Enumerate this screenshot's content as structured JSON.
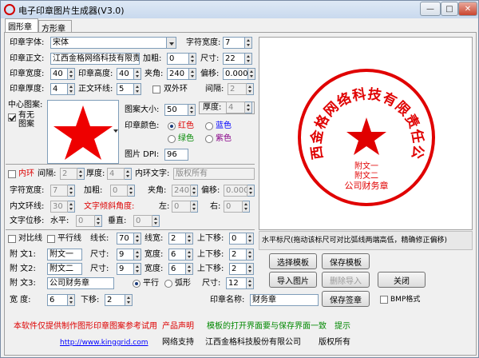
{
  "window": {
    "title": "电子印章图片生成器(V3.0)",
    "min": "—",
    "max": "□",
    "close": "✕"
  },
  "tabs": [
    {
      "label": "圆形章"
    },
    {
      "label": "方形章"
    }
  ],
  "form": {
    "font_label": "印章字体:",
    "font_value": "宋体",
    "char_width_label": "字符宽度:",
    "char_width": "7",
    "text_label": "印章正文:",
    "text_value": "江西金格网络科技有限责",
    "bold_label": "加粗:",
    "bold": "0",
    "size_label": "尺寸:",
    "size": "22",
    "seal_width_label": "印章宽度:",
    "seal_width": "40",
    "seal_height_label": "印章高度:",
    "seal_height": "40",
    "angle_label": "夹角:",
    "angle": "240",
    "offset_label": "偏移:",
    "offset": "0.000",
    "thickness_label": "印章厚度:",
    "thickness": "4",
    "text_ring_label": "正文环线:",
    "text_ring": "5",
    "double_ring_label": "双外环",
    "gap_label": "间隔:",
    "gap": "2",
    "center_label": "中心图案:",
    "has_pattern_label": "有无图案",
    "ring_thickness_label": "厚度:",
    "ring_thickness": "4",
    "pattern_size_label": "图案大小:",
    "pattern_size": "50",
    "color_label": "印章颜色:",
    "colors": {
      "red": "红色",
      "blue": "蓝色",
      "green": "绿色",
      "purple": "紫色"
    },
    "dpi_label": "图片 DPI:",
    "dpi": "96"
  },
  "inner": {
    "inner_ring_label": "内环",
    "gap_label": "间隔:",
    "gap": "2",
    "thickness_label": "厚度:",
    "thickness": "4",
    "inner_text_label": "内环文字:",
    "inner_text": "版权所有",
    "char_width_label": "字符宽度:",
    "char_width": "7",
    "bold_label": "加粗:",
    "bold": "0",
    "angle_label": "夹角:",
    "angle": "240",
    "offset_label": "偏移:",
    "offset": "0.000",
    "text_ring_label": "内文环线:",
    "text_ring": "30",
    "tilt_label": "文字倾斜角度:",
    "left_label": "左:",
    "left": "0",
    "right_label": "右:",
    "right": "0",
    "shift_label": "文字位移:",
    "horiz_label": "水平:",
    "horiz": "0",
    "vert_label": "垂直:",
    "vert": "0"
  },
  "lines": {
    "contrast_label": "对比线",
    "parallel_label": "平行线",
    "length_label": "线长:",
    "length": "70",
    "width_label": "线宽:",
    "width": "2",
    "updown_label": "上下移:",
    "updown": "0",
    "sub1_label": "附  文1:",
    "sub1": "附文一",
    "sub1_size_label": "尺寸:",
    "sub1_size": "9",
    "sub1_w_label": "宽度:",
    "sub1_w": "6",
    "sub1_ud_label": "上下移:",
    "sub1_ud": "2",
    "sub2_label": "附  文2:",
    "sub2": "附文二",
    "sub2_size_label": "尺寸:",
    "sub2_size": "9",
    "sub2_w_label": "宽度:",
    "sub2_w": "6",
    "sub2_ud_label": "上下移:",
    "sub2_ud": "2",
    "sub3_label": "附  文3:",
    "sub3": "公司财务章",
    "parallel_r": "平行",
    "arc_r": "弧形",
    "sub3_size_label": "尺寸:",
    "sub3_size": "12",
    "w_label": "宽    度:",
    "w": "6",
    "down_label": "下移:",
    "down": "2",
    "seal_name_label": "印章名称:",
    "seal_name": "财务章"
  },
  "buttons": {
    "select_tpl": "选择模板",
    "save_tpl": "保存模板",
    "import_img": "导入图片",
    "delete_import": "删除导入",
    "close": "关闭",
    "save_seal": "保存签章",
    "bmp_label": "BMP格式"
  },
  "slider_hint": "水平标尺(拖动该标尺可对比弧线两端高低，精确修正偏移)",
  "stamp": {
    "ring_text": "江西金格网络科技有限责任公司",
    "sub1": "附文一",
    "sub2": "附文二",
    "sub3": "公司财务章",
    "color": "#e00000"
  },
  "footer": {
    "note1": "本软件仅提供制作图形印章图案参考试用",
    "note2": "产品声明",
    "note3": "模板的打开界面要与保存界面一致",
    "note4": "提示",
    "url": "http://www.kinggrid.com",
    "support": "网络支持",
    "company": "江西金格科技股份有限公司",
    "rights": "版权所有"
  }
}
